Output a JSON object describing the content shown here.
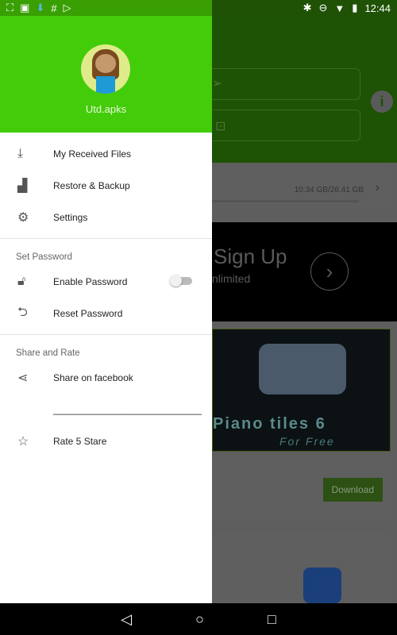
{
  "status": {
    "time": "12:44",
    "left_icons": [
      "screenshot-icon",
      "image-icon",
      "download-icon",
      "hash-icon",
      "play-icon"
    ]
  },
  "drawer": {
    "username": "Utd.apks",
    "items": [
      {
        "label": "My Received Files",
        "icon": "download-icon"
      },
      {
        "label": "Restore & Backup",
        "icon": "android-icon"
      },
      {
        "label": "Settings",
        "icon": "gear-icon"
      }
    ],
    "password_section": "Set Password",
    "password_items": [
      {
        "label": "Enable Password",
        "icon": "lock-icon",
        "toggle": false
      },
      {
        "label": "Reset Password",
        "icon": "reset-icon"
      }
    ],
    "share_section": "Share and Rate",
    "share_items": [
      {
        "label": "Share on facebook",
        "icon": "share-icon"
      },
      {
        "label": "____________________________"
      },
      {
        "label": "Rate 5 Stare",
        "icon": "star-icon"
      }
    ]
  },
  "background": {
    "storage": "10.34 GB/26.41 GB",
    "ad_title": "Sign Up",
    "ad_sub": "nlimited",
    "promo_title": "Piano tiles 6",
    "promo_sub": "For Free",
    "download": "Download"
  }
}
